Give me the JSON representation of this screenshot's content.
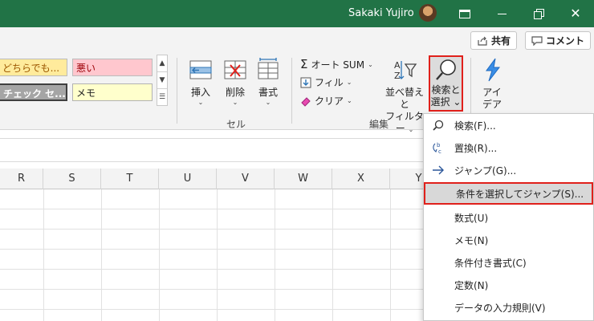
{
  "titlebar": {
    "user_name": "Sakaki Yujiro",
    "icons": [
      "ribbon-display-icon",
      "minimize-icon",
      "restore-icon",
      "close-icon"
    ]
  },
  "ribbon": {
    "share_label": "共有",
    "comment_label": "コメント",
    "styles": {
      "row1": [
        "どちらでも...",
        "悪い"
      ],
      "row2": [
        "チェック セ...",
        "メモ"
      ]
    },
    "cells_group": {
      "insert_label": "挿入",
      "delete_label": "削除",
      "format_label": "書式",
      "group_label": "セル"
    },
    "editing_group": {
      "autosum_label": "オート SUM",
      "fill_label": "フィル",
      "clear_label": "クリア",
      "sort_line1": "並べ替えと",
      "sort_line2": "フィルター",
      "find_line1": "検索と",
      "find_line2": "選択",
      "group_label": "編集"
    },
    "ideas": {
      "line1": "アイ",
      "line2": "デア"
    }
  },
  "columns": [
    "R",
    "S",
    "T",
    "U",
    "V",
    "W",
    "X",
    "Y"
  ],
  "menu": {
    "items": [
      {
        "label": "検索(F)...",
        "icon": "search-icon"
      },
      {
        "label": "置換(R)...",
        "icon": "replace-icon"
      },
      {
        "label": "ジャンプ(G)...",
        "icon": "arrow-right-icon"
      },
      {
        "label": "条件を選択してジャンプ(S)...",
        "icon": ""
      },
      {
        "label": "数式(U)",
        "icon": ""
      },
      {
        "label": "メモ(N)",
        "icon": ""
      },
      {
        "label": "条件付き書式(C)",
        "icon": ""
      },
      {
        "label": "定数(N)",
        "icon": ""
      },
      {
        "label": "データの入力規則(V)",
        "icon": ""
      }
    ],
    "highlighted_index": 3
  },
  "colors": {
    "title_green": "#217346",
    "highlight_red": "#e0201b",
    "neutral_fill": "#ffeb9c",
    "bad_fill": "#ffc7ce",
    "note_fill": "#ffffcc",
    "check_fill": "#a5a5a5"
  }
}
